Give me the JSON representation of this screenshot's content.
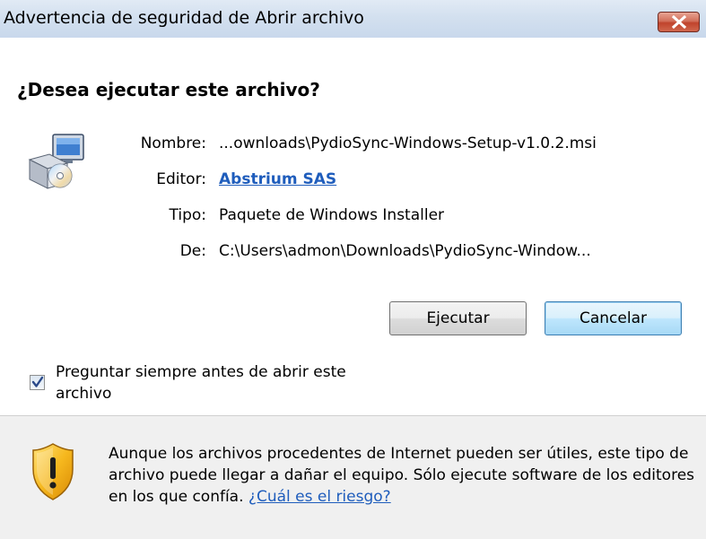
{
  "window": {
    "title": "Advertencia de seguridad de Abrir archivo",
    "close_label": "Cerrar"
  },
  "dialog": {
    "question": "¿Desea ejecutar este archivo?",
    "file_icon": "installer-package-icon",
    "details": {
      "name_label": "Nombre:",
      "name_value": "...ownloads\\PydioSync-Windows-Setup-v1.0.2.msi",
      "publisher_label": "Editor:",
      "publisher_value": "Abstrium SAS",
      "type_label": "Tipo:",
      "type_value": "Paquete de Windows Installer",
      "from_label": "De:",
      "from_value": "C:\\Users\\admon\\Downloads\\PydioSync-Window..."
    },
    "buttons": {
      "run": "Ejecutar",
      "cancel": "Cancelar"
    },
    "checkbox": {
      "label": "Preguntar siempre antes de abrir este archivo",
      "checked": true
    },
    "warning": {
      "icon": "warning-shield-icon",
      "text": "Aunque los archivos procedentes de Internet pueden ser útiles, este tipo de archivo puede llegar a dañar el equipo. Sólo ejecute software de los editores en los que confía.",
      "link": "¿Cuál es el riesgo?"
    }
  },
  "colors": {
    "link": "#1f5dbc",
    "titlebar": "#d3e0ef",
    "close_button": "#c0432c",
    "bottom_panel": "#f0f0f0"
  }
}
